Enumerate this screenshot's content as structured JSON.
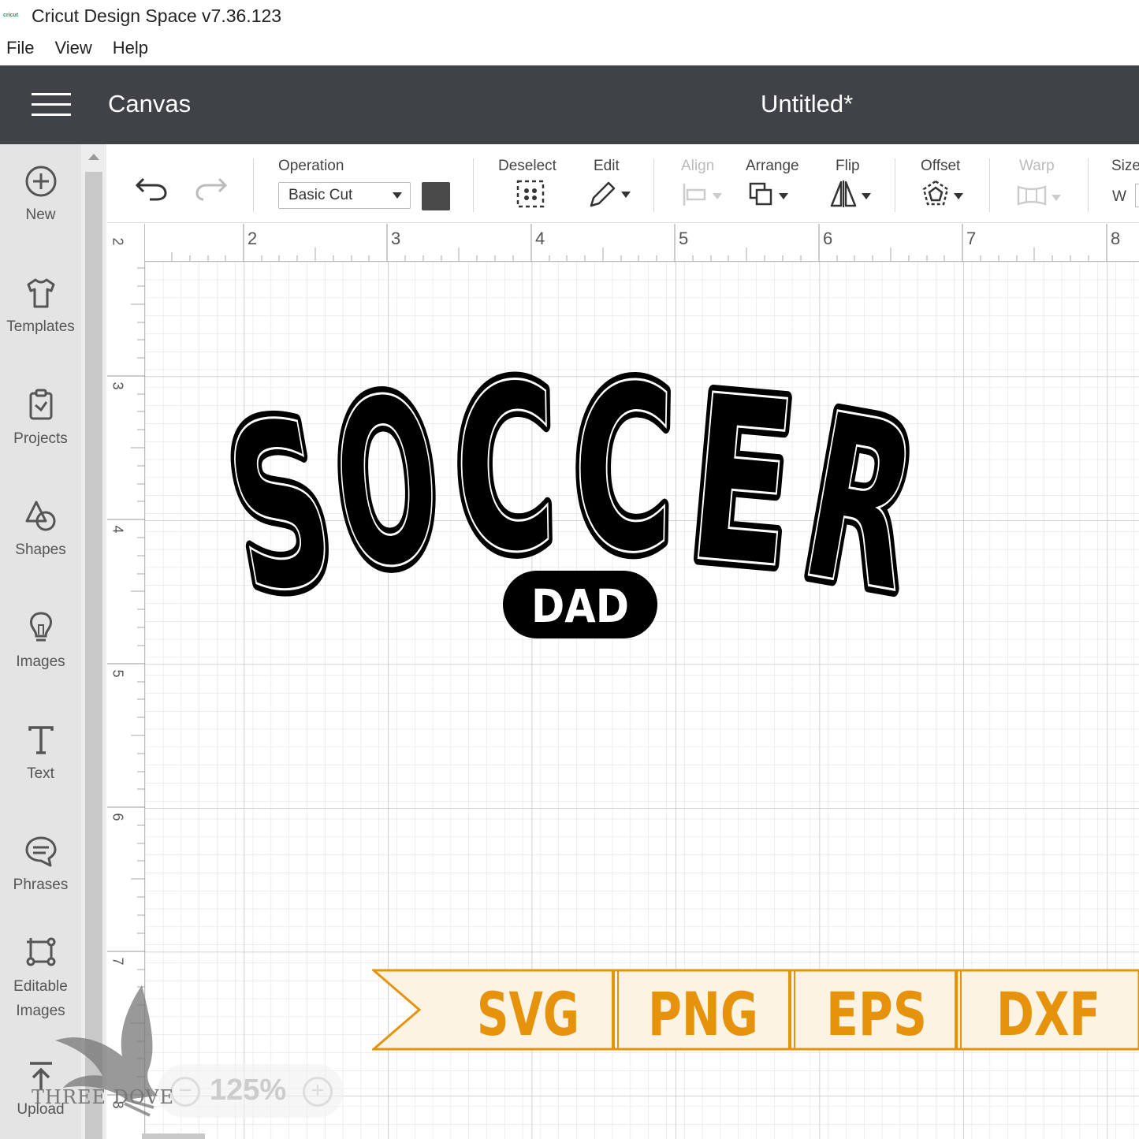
{
  "app": {
    "logo_text": "cricut",
    "title": "Cricut Design Space  v7.36.123"
  },
  "menu": [
    "File",
    "View",
    "Help"
  ],
  "header": {
    "section": "Canvas",
    "document": "Untitled*"
  },
  "sidebar": {
    "items": [
      {
        "label": "New",
        "icon": "plus-circle-icon"
      },
      {
        "label": "Templates",
        "icon": "tshirt-icon"
      },
      {
        "label": "Projects",
        "icon": "clipboard-icon"
      },
      {
        "label": "Shapes",
        "icon": "shapes-icon"
      },
      {
        "label": "Images",
        "icon": "lightbulb-icon"
      },
      {
        "label": "Text",
        "icon": "text-t-icon"
      },
      {
        "label": "Phrases",
        "icon": "speech-bubble-icon"
      },
      {
        "label": "Editable Images",
        "icon": "editable-image-icon"
      },
      {
        "label": "Upload",
        "icon": "upload-icon"
      }
    ]
  },
  "toolbar": {
    "operation_label": "Operation",
    "operation_value": "Basic Cut",
    "swatch_color": "#4a4a4a",
    "deselect": "Deselect",
    "edit": "Edit",
    "align": "Align",
    "arrange": "Arrange",
    "flip": "Flip",
    "offset": "Offset",
    "warp": "Warp",
    "size": "Size",
    "size_w": "W"
  },
  "ruler": {
    "top": [
      "2",
      "2",
      "3",
      "4",
      "5",
      "6",
      "7",
      "8"
    ],
    "left": [
      "3",
      "4",
      "5",
      "6",
      "7",
      "8"
    ]
  },
  "design": {
    "main_text": "SOCCER",
    "sub_text": "DAD"
  },
  "zoom": {
    "value": "125%"
  },
  "banner": {
    "formats": [
      "SVG",
      "PNG",
      "EPS",
      "DXF"
    ],
    "accent": "#e6920b",
    "fill": "#fdf3e3"
  },
  "watermark": {
    "text": "THREE DOVE"
  }
}
